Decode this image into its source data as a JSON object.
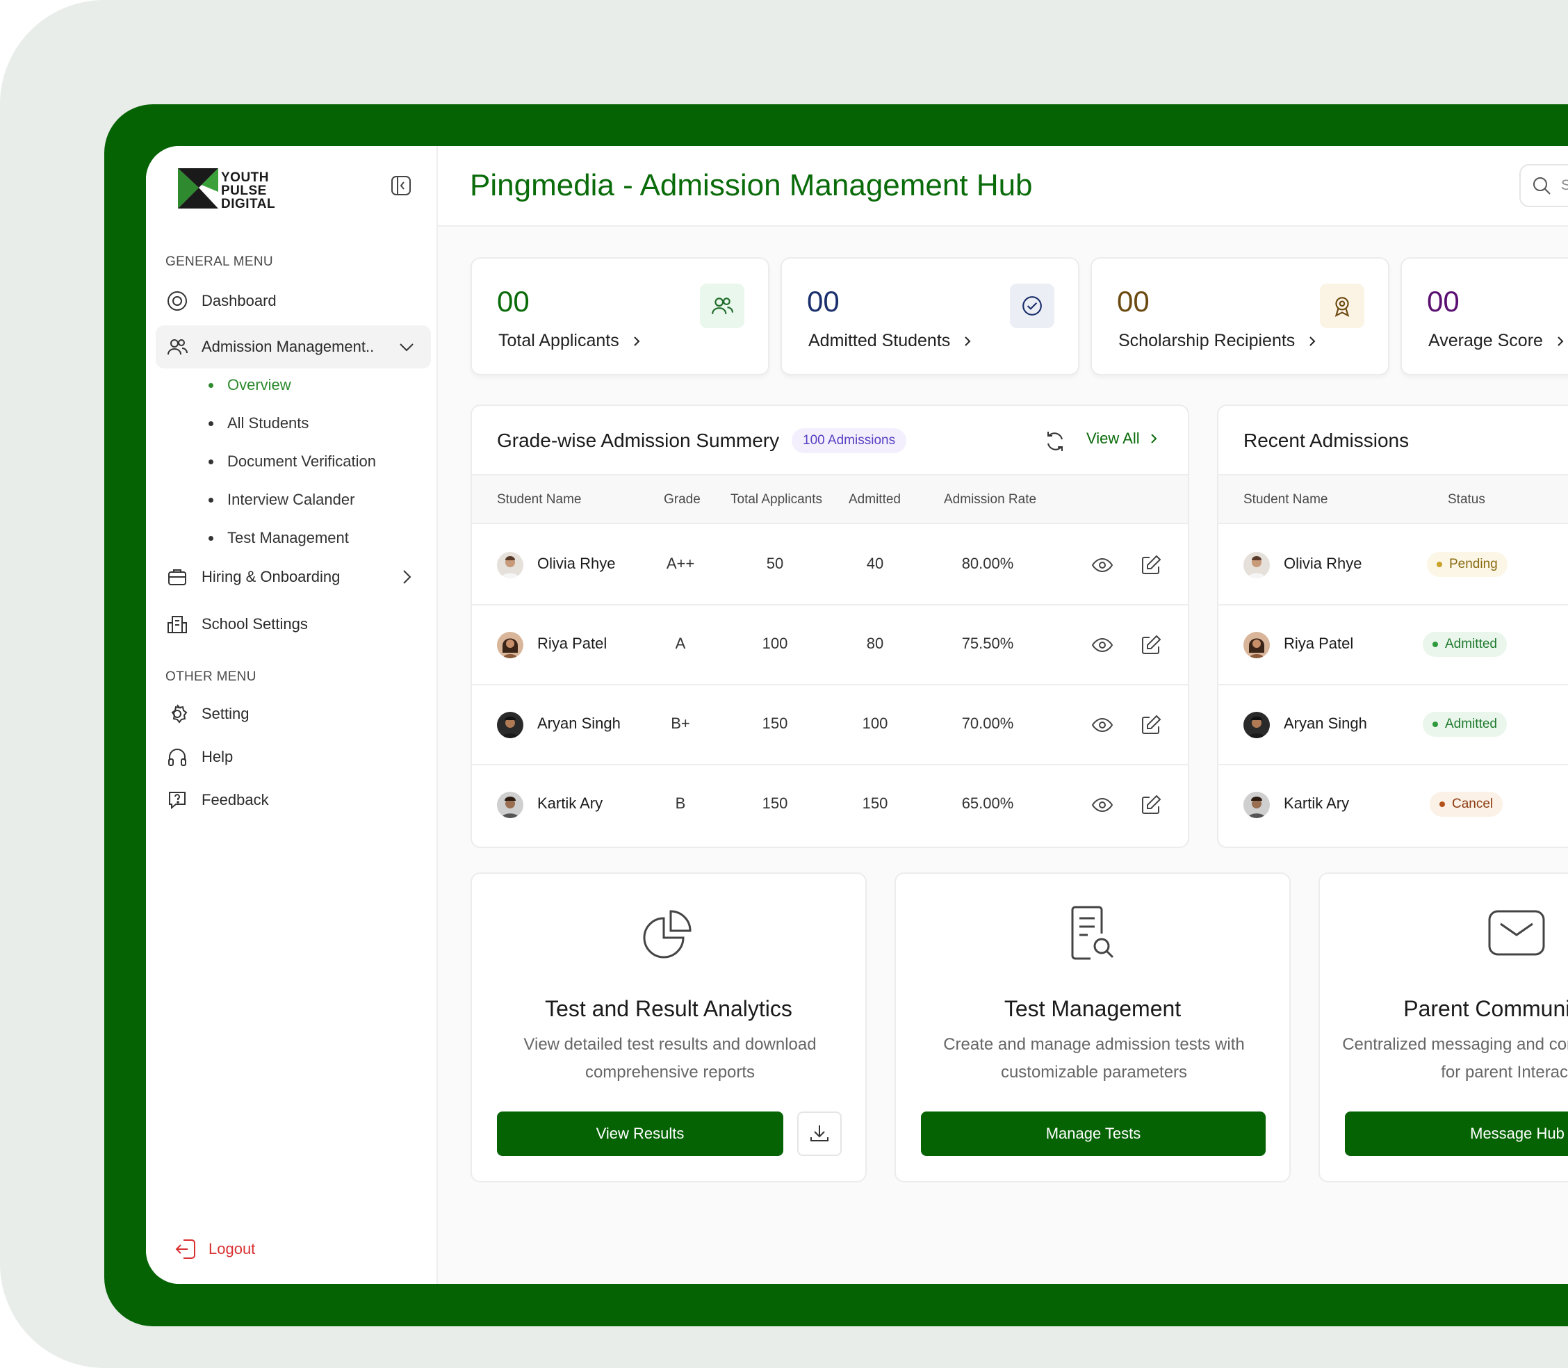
{
  "brand": {
    "logo_text_1": "YOUTH",
    "logo_text_2": "PULSE",
    "logo_text_3": "DIGITAL"
  },
  "sidebar": {
    "general_heading": "GENERAL MENU",
    "other_heading": "OTHER MENU",
    "items": [
      {
        "label": "Dashboard",
        "icon": "compass-icon"
      },
      {
        "label": "Admission Management..",
        "icon": "users-icon"
      },
      {
        "label": "Hiring & Onboarding",
        "icon": "briefcase-icon"
      },
      {
        "label": "School Settings",
        "icon": "building-icon"
      }
    ],
    "sub_items": [
      {
        "label": "Overview",
        "active": true
      },
      {
        "label": "All Students"
      },
      {
        "label": "Document Verification"
      },
      {
        "label": "Interview Calander"
      },
      {
        "label": "Test Management"
      }
    ],
    "other_items": [
      {
        "label": "Setting",
        "icon": "gear-icon"
      },
      {
        "label": "Help",
        "icon": "headphones-icon"
      },
      {
        "label": "Feedback",
        "icon": "feedback-icon"
      }
    ],
    "logout": "Logout"
  },
  "header": {
    "title": "Pingmedia - Admission Management Hub",
    "search_placeholder": "Search anything..."
  },
  "stats": [
    {
      "value": "00",
      "label": "Total Applicants",
      "color": "#0a6b0a",
      "badge_bg": "#e9f7ec",
      "icon": "users-icon"
    },
    {
      "value": "00",
      "label": "Admitted Students",
      "color": "#1a2f6b",
      "badge_bg": "#eceef5",
      "icon": "check-circle-icon"
    },
    {
      "value": "00",
      "label": "Scholarship Recipients",
      "color": "#6b4a12",
      "badge_bg": "#fbf3e4",
      "icon": "award-icon"
    },
    {
      "value": "00",
      "label": "Average Score",
      "color": "#5a1070",
      "badge_bg": "#f4eaf8",
      "icon": "chart-icon"
    }
  ],
  "summary": {
    "title": "Grade-wise Admission Summery",
    "pill": "100 Admissions",
    "view_all": "View All",
    "columns": [
      "Student Name",
      "Grade",
      "Total Applicants",
      "Admitted",
      "Admission Rate"
    ],
    "rows": [
      {
        "name": "Olivia Rhye",
        "grade": "A++",
        "total": "50",
        "admitted": "40",
        "rate": "80.00%"
      },
      {
        "name": "Riya Patel",
        "grade": "A",
        "total": "100",
        "admitted": "80",
        "rate": "75.50%"
      },
      {
        "name": "Aryan Singh",
        "grade": "B+",
        "total": "150",
        "admitted": "100",
        "rate": "70.00%"
      },
      {
        "name": "Kartik Ary",
        "grade": "B",
        "total": "150",
        "admitted": "150",
        "rate": "65.00%"
      }
    ]
  },
  "recent": {
    "title": "Recent Admissions",
    "columns": [
      "Student Name",
      "Status"
    ],
    "rows": [
      {
        "name": "Olivia Rhye",
        "status": "Pending",
        "bg": "#fbf6e6",
        "fg": "#8a6a10",
        "dot": "#c9a227"
      },
      {
        "name": "Riya Patel",
        "status": "Admitted",
        "bg": "#eaf6ec",
        "fg": "#1f7a2e",
        "dot": "#2e9a3c"
      },
      {
        "name": "Aryan Singh",
        "status": "Admitted",
        "bg": "#eaf6ec",
        "fg": "#1f7a2e",
        "dot": "#2e9a3c"
      },
      {
        "name": "Kartik Ary",
        "status": "Cancel",
        "bg": "#fbf1e6",
        "fg": "#8a3a10",
        "dot": "#b4521b"
      }
    ]
  },
  "features": [
    {
      "title": "Test and Result Analytics",
      "desc": "View detailed test results and download comprehensive reports",
      "button": "View Results",
      "icon": "pie-chart-icon"
    },
    {
      "title": "Test Management",
      "desc": "Create and manage admission tests with customizable parameters",
      "button": "Manage Tests",
      "icon": "document-search-icon"
    },
    {
      "title": "Parent Communication",
      "desc": "Centralized messaging and communication hub for parent Interaction",
      "button": "Message Hub",
      "icon": "mail-icon"
    }
  ]
}
